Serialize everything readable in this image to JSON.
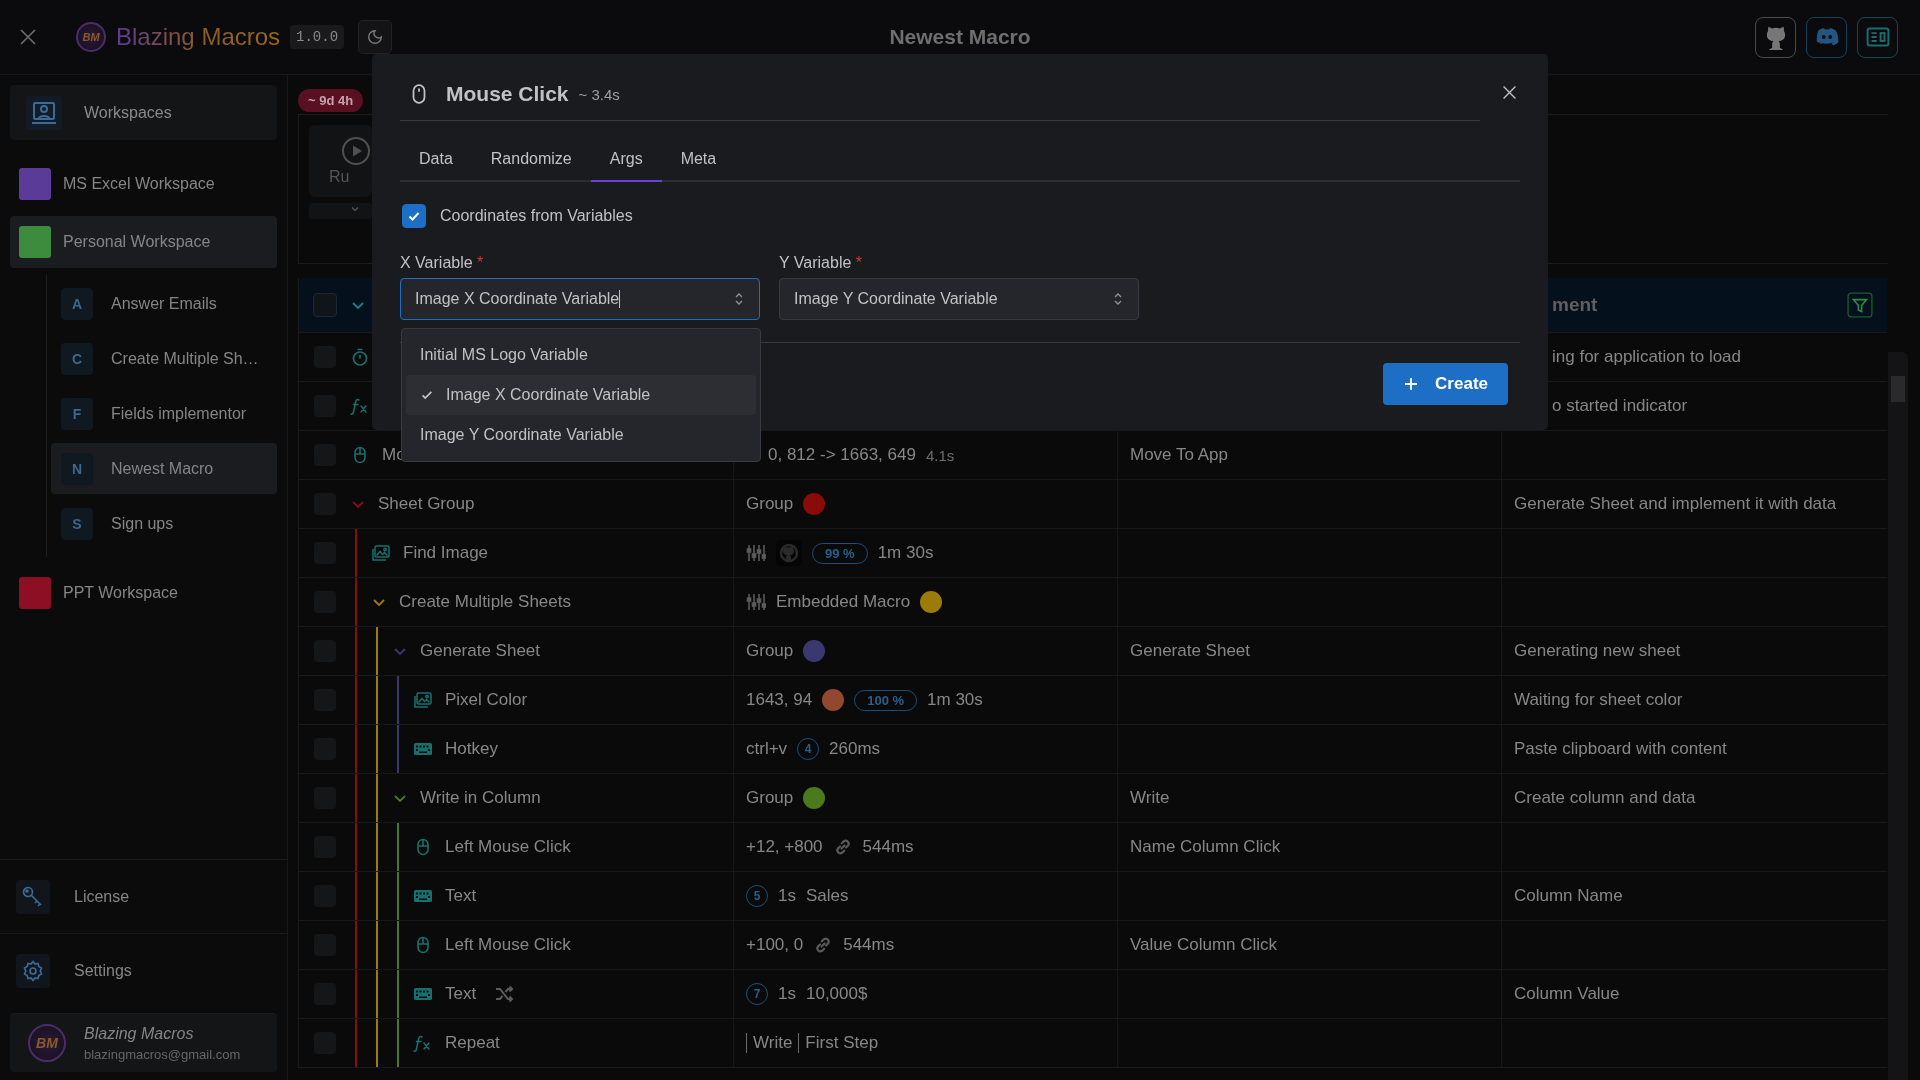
{
  "app": {
    "name": "Blazing Macros",
    "logo_text": "BM",
    "version": "1.0.0"
  },
  "window": {
    "title": "Newest Macro"
  },
  "sidebar": {
    "workspaces_button": {
      "label": "Workspaces"
    },
    "workspaces": [
      {
        "name": "MS Excel Workspace",
        "color": "#5a3c98",
        "expanded": false
      },
      {
        "name": "Personal Workspace",
        "color": "#3d8b3d",
        "expanded": true,
        "macros": [
          {
            "letter": "A",
            "name": "Answer Emails",
            "selected": false
          },
          {
            "letter": "C",
            "name": "Create Multiple Sh…",
            "selected": false
          },
          {
            "letter": "F",
            "name": "Fields implementor",
            "selected": false
          },
          {
            "letter": "N",
            "name": "Newest Macro",
            "selected": true
          },
          {
            "letter": "S",
            "name": "Sign ups",
            "selected": false
          }
        ]
      },
      {
        "name": "PPT Workspace",
        "color": "#8c0f24",
        "expanded": false
      }
    ],
    "footer_nav": [
      {
        "kind": "license",
        "label": "License"
      },
      {
        "kind": "settings",
        "label": "Settings"
      }
    ],
    "user": {
      "avatar_text": "BM",
      "name": "Blazing Macros",
      "email": "blazingmacros@gmail.com"
    }
  },
  "main": {
    "duration_badge": "~ 9d 4h",
    "run_label": "Ru",
    "table": {
      "header": {
        "visible_text": "ment",
        "checked": false
      },
      "rows": [
        {
          "kind": "timer",
          "checked": false,
          "behind_dialog": true,
          "randomized": false,
          "comment": "ing for application to load"
        },
        {
          "kind": "function",
          "checked": false,
          "behind_dialog": true,
          "randomized": false,
          "comment": "o started indicator"
        },
        {
          "kind": "mouse",
          "checked": false,
          "behind_dialog": true,
          "randomized": false,
          "name": "Mo",
          "details": [
            {
              "kind": "text",
              "text": "0, 812 -> 1663, 649"
            },
            {
              "kind": "muted",
              "text": "4.1s"
            }
          ],
          "label": "Move To App"
        },
        {
          "name": "Sheet Group",
          "color": "#8b0a0a",
          "expanded": true,
          "checked": false,
          "behind_dialog": false,
          "randomized": false,
          "details": [
            {
              "kind": "text",
              "text": "Group"
            },
            {
              "kind": "dot"
            }
          ],
          "comment": "Generate Sheet and implement it with data",
          "children": [
            {
              "kind": "image",
              "name": "Find Image",
              "checked": false,
              "behind_dialog": false,
              "randomized": false,
              "details": [
                {
                  "kind": "sliders-icon"
                },
                {
                  "kind": "template-icon"
                },
                {
                  "kind": "percent",
                  "text": "99 %"
                },
                {
                  "kind": "text",
                  "text": "1m 30s"
                }
              ]
            },
            {
              "name": "Create Multiple Sheets",
              "color": "#9c7b08",
              "expanded": true,
              "checked": false,
              "behind_dialog": false,
              "randomized": false,
              "details": [
                {
                  "kind": "sliders-icon"
                },
                {
                  "kind": "text",
                  "text": "Embedded Macro"
                },
                {
                  "kind": "dot"
                }
              ],
              "children": [
                {
                  "name": "Generate Sheet",
                  "color": "#3b3870",
                  "expanded": true,
                  "checked": false,
                  "behind_dialog": false,
                  "randomized": false,
                  "details": [
                    {
                      "kind": "text",
                      "text": "Group"
                    },
                    {
                      "kind": "dot"
                    }
                  ],
                  "label": "Generate Sheet",
                  "comment": "Generating new sheet",
                  "children": [
                    {
                      "kind": "image",
                      "name": "Pixel Color",
                      "checked": false,
                      "behind_dialog": false,
                      "randomized": false,
                      "details": [
                        {
                          "kind": "text",
                          "text": "1643, 94"
                        },
                        {
                          "kind": "swatch",
                          "color": "#94472f"
                        },
                        {
                          "kind": "percent",
                          "text": "100 %"
                        },
                        {
                          "kind": "text",
                          "text": "1m 30s"
                        }
                      ],
                      "comment": "Waiting for sheet color"
                    },
                    {
                      "kind": "keyboard",
                      "name": "Hotkey",
                      "checked": false,
                      "behind_dialog": false,
                      "randomized": false,
                      "details": [
                        {
                          "kind": "text",
                          "text": "ctrl+v"
                        },
                        {
                          "kind": "count",
                          "text": "4"
                        },
                        {
                          "kind": "text",
                          "text": "260ms"
                        }
                      ],
                      "comment": "Paste clipboard with content"
                    }
                  ]
                },
                {
                  "name": "Write in Column",
                  "color": "#4a7a1c",
                  "expanded": true,
                  "checked": false,
                  "behind_dialog": false,
                  "randomized": false,
                  "details": [
                    {
                      "kind": "text",
                      "text": "Group"
                    },
                    {
                      "kind": "dot"
                    }
                  ],
                  "label": "Write",
                  "comment": "Create column and data",
                  "children": [
                    {
                      "kind": "mouse",
                      "name": "Left Mouse Click",
                      "checked": false,
                      "behind_dialog": false,
                      "randomized": false,
                      "details": [
                        {
                          "kind": "text",
                          "text": "+12, +800"
                        },
                        {
                          "kind": "link-icon"
                        },
                        {
                          "kind": "text",
                          "text": "544ms"
                        }
                      ],
                      "label": "Name Column Click"
                    },
                    {
                      "kind": "keyboard",
                      "name": "Text",
                      "checked": false,
                      "behind_dialog": false,
                      "randomized": false,
                      "details": [
                        {
                          "kind": "count",
                          "text": "5"
                        },
                        {
                          "kind": "text",
                          "text": "1s"
                        },
                        {
                          "kind": "text",
                          "text": "Sales"
                        }
                      ],
                      "comment": "Column Name"
                    },
                    {
                      "kind": "mouse",
                      "name": "Left Mouse Click",
                      "checked": false,
                      "behind_dialog": false,
                      "randomized": false,
                      "details": [
                        {
                          "kind": "text",
                          "text": "+100, 0"
                        },
                        {
                          "kind": "link-icon"
                        },
                        {
                          "kind": "text",
                          "text": "544ms"
                        }
                      ],
                      "label": "Value Column Click"
                    },
                    {
                      "kind": "keyboard",
                      "name": "Text",
                      "checked": false,
                      "behind_dialog": false,
                      "randomized": true,
                      "details": [
                        {
                          "kind": "count",
                          "text": "7"
                        },
                        {
                          "kind": "text",
                          "text": "1s"
                        },
                        {
                          "kind": "text",
                          "text": "10,000$"
                        }
                      ],
                      "comment": "Column Value"
                    },
                    {
                      "kind": "function",
                      "name": "Repeat",
                      "checked": false,
                      "behind_dialog": false,
                      "randomized": false,
                      "details": [
                        {
                          "kind": "ref",
                          "text": "Write"
                        },
                        {
                          "kind": "ref",
                          "text": "First Step"
                        }
                      ]
                    }
                  ]
                }
              ]
            }
          ]
        }
      ]
    }
  },
  "dialog": {
    "title": "Mouse Click",
    "duration": "~ 3.4s",
    "tabs": [
      {
        "label": "Data",
        "selected": false
      },
      {
        "label": "Randomize",
        "selected": false
      },
      {
        "label": "Args",
        "selected": true
      },
      {
        "label": "Meta",
        "selected": false
      }
    ],
    "checkbox": {
      "label": "Coordinates from Variables",
      "checked": true
    },
    "fields": [
      {
        "label": "X Variable",
        "required_mark": "*",
        "value": "Image X Coordinate Variable",
        "focused": true
      },
      {
        "label": "Y Variable",
        "required_mark": "*",
        "value": "Image Y Coordinate Variable",
        "focused": false
      }
    ],
    "dropdown": {
      "options": [
        {
          "label": "Initial MS Logo Variable",
          "selected": false
        },
        {
          "label": "Image X Coordinate Variable",
          "selected": true
        },
        {
          "label": "Image Y Coordinate Variable",
          "selected": false
        }
      ]
    },
    "create_button": {
      "label": "Create"
    }
  }
}
